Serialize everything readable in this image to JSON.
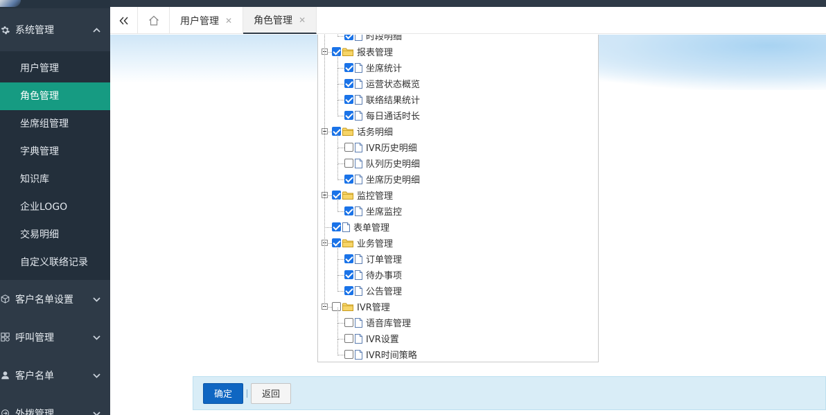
{
  "sidebar": {
    "expanded_group": {
      "icon": "gear-icon",
      "label": "系统管理"
    },
    "sub_items": [
      {
        "label": "用户管理",
        "active": false
      },
      {
        "label": "角色管理",
        "active": true
      },
      {
        "label": "坐席组管理",
        "active": false
      },
      {
        "label": "字典管理",
        "active": false
      },
      {
        "label": "知识库",
        "active": false
      },
      {
        "label": "企业LOGO",
        "active": false
      },
      {
        "label": "交易明细",
        "active": false
      },
      {
        "label": "自定义联络记录",
        "active": false
      }
    ],
    "collapsed_groups": [
      {
        "icon": "cube-icon",
        "label": "客户名单设置"
      },
      {
        "icon": "grid-icon",
        "label": "呼叫管理"
      },
      {
        "icon": "user-icon",
        "label": "客户名单"
      },
      {
        "icon": "outbound-icon",
        "label": "外拨管理"
      }
    ]
  },
  "tabs": [
    {
      "label": "用户管理",
      "active": false
    },
    {
      "label": "角色管理",
      "active": true
    }
  ],
  "tree": [
    {
      "level": 2,
      "label": "时段明细",
      "checked": true,
      "type": "doc"
    },
    {
      "level": 1,
      "label": "报表管理",
      "checked": true,
      "type": "folder"
    },
    {
      "level": 2,
      "label": "坐席统计",
      "checked": true,
      "type": "doc"
    },
    {
      "level": 2,
      "label": "运营状态概览",
      "checked": true,
      "type": "doc"
    },
    {
      "level": 2,
      "label": "联络结果统计",
      "checked": true,
      "type": "doc"
    },
    {
      "level": 2,
      "label": "每日通话时长",
      "checked": true,
      "type": "doc"
    },
    {
      "level": 1,
      "label": "话务明细",
      "checked": true,
      "type": "folder"
    },
    {
      "level": 2,
      "label": "IVR历史明细",
      "checked": false,
      "type": "doc"
    },
    {
      "level": 2,
      "label": "队列历史明细",
      "checked": false,
      "type": "doc"
    },
    {
      "level": 2,
      "label": "坐席历史明细",
      "checked": true,
      "type": "doc"
    },
    {
      "level": 1,
      "label": "监控管理",
      "checked": true,
      "type": "folder"
    },
    {
      "level": 2,
      "label": "坐席监控",
      "checked": true,
      "type": "doc"
    },
    {
      "level": 1,
      "label": "表单管理",
      "checked": true,
      "type": "doc-leaf"
    },
    {
      "level": 1,
      "label": "业务管理",
      "checked": true,
      "type": "folder"
    },
    {
      "level": 2,
      "label": "订单管理",
      "checked": true,
      "type": "doc"
    },
    {
      "level": 2,
      "label": "待办事项",
      "checked": true,
      "type": "doc"
    },
    {
      "level": 2,
      "label": "公告管理",
      "checked": true,
      "type": "doc"
    },
    {
      "level": 1,
      "label": "IVR管理",
      "checked": false,
      "type": "folder"
    },
    {
      "level": 2,
      "label": "语音库管理",
      "checked": false,
      "type": "doc"
    },
    {
      "level": 2,
      "label": "IVR设置",
      "checked": false,
      "type": "doc"
    },
    {
      "level": 2,
      "label": "IVR时间策略",
      "checked": false,
      "type": "doc"
    }
  ],
  "buttons": {
    "confirm": "确定",
    "back": "返回"
  },
  "colors": {
    "sidebar_bg": "#2e3a47",
    "active_item": "#169b82",
    "checkbox_on": "#1a73e8",
    "confirm_btn": "#0f66c2"
  }
}
